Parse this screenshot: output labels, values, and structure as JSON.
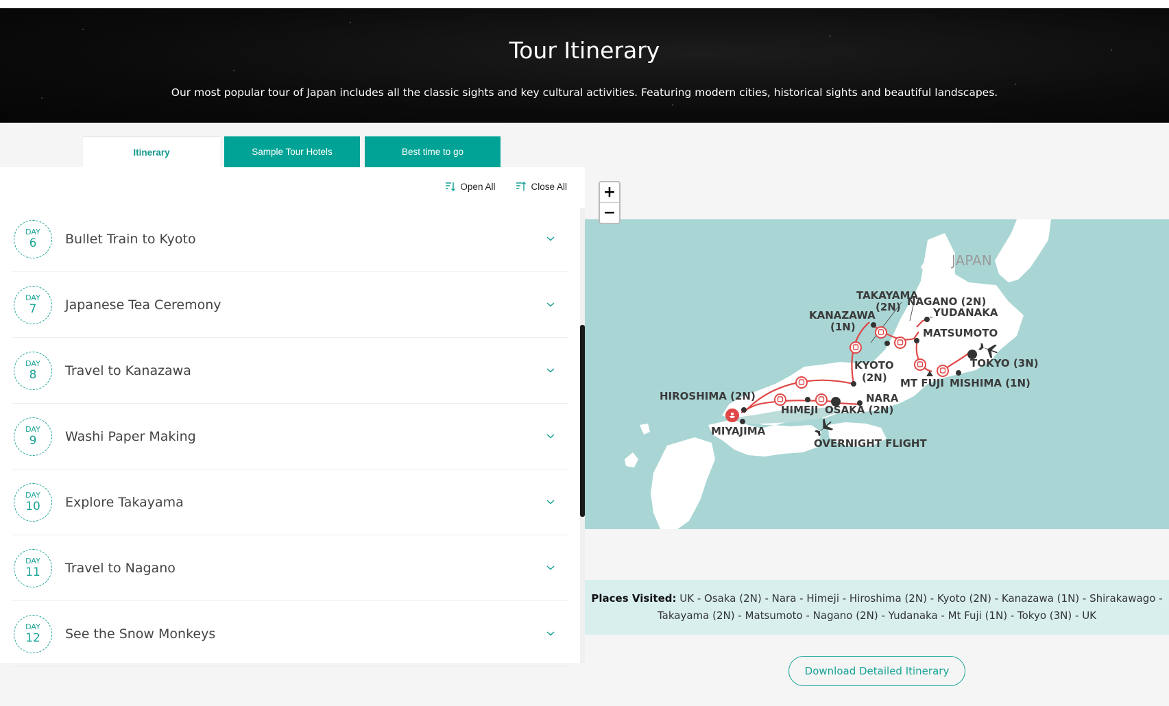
{
  "hero": {
    "title": "Tour Itinerary",
    "subtitle": "Our most popular tour of Japan includes all the classic sights and key cultural activities. Featuring modern cities, historical sights and beautiful landscapes."
  },
  "tabs": [
    {
      "label": "Itinerary",
      "active": true
    },
    {
      "label": "Sample Tour Hotels",
      "active": false
    },
    {
      "label": "Best time to go",
      "active": false
    }
  ],
  "controls": {
    "open_all": "Open All",
    "close_all": "Close All"
  },
  "days": [
    {
      "label": "DAY",
      "num": "6",
      "title": "Bullet Train to Kyoto"
    },
    {
      "label": "DAY",
      "num": "7",
      "title": "Japanese Tea Ceremony"
    },
    {
      "label": "DAY",
      "num": "8",
      "title": "Travel to Kanazawa"
    },
    {
      "label": "DAY",
      "num": "9",
      "title": "Washi Paper Making"
    },
    {
      "label": "DAY",
      "num": "10",
      "title": "Explore Takayama"
    },
    {
      "label": "DAY",
      "num": "11",
      "title": "Travel to Nagano"
    },
    {
      "label": "DAY",
      "num": "12",
      "title": "See the Snow Monkeys"
    }
  ],
  "map": {
    "zoom_in": "+",
    "zoom_out": "−",
    "country_label": "JAPAN",
    "labels": {
      "takayama": [
        "TAKAYAMA",
        "(2N)"
      ],
      "nagano": "NAGANO (2N)",
      "yudanaka": "YUDANAKA",
      "kanazawa": [
        "KANAZAWA",
        "(1N)"
      ],
      "matsumoto": "MATSUMOTO",
      "kyoto": [
        "KYOTO",
        "(2N)"
      ],
      "tokyo": "TOKYO (3N)",
      "mtfuji": "MT FUJI",
      "mishima": "MISHIMA (1N)",
      "hiroshima": "HIROSHIMA (2N)",
      "nara": "NARA",
      "himeji": "HIMEJI",
      "osaka": "OSAKA (2N)",
      "miyajima": "MIYAJIMA",
      "overnight": "OVERNIGHT FLIGHT"
    },
    "colors": {
      "sea": "#a9d6d4",
      "land": "#ffffff",
      "route": "#e04848",
      "marker": "#3a3a3a"
    }
  },
  "places": {
    "label": "Places Visited:",
    "line1": "UK - Osaka (2N) - Nara - Himeji - Hiroshima (2N) - Kyoto (2N) - Kanazawa (1N) - Shirakawago -",
    "line2": "Takayama (2N) - Matsumoto - Nagano (2N) - Yudanaka - Mt Fuji (1N) - Tokyo (3N) - UK"
  },
  "download_label": "Download Detailed Itinerary",
  "accent": "#00a395"
}
